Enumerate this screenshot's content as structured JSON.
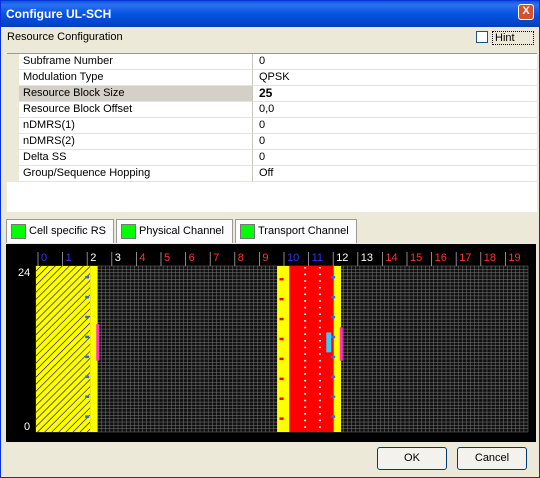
{
  "window": {
    "title": "Configure UL-SCH",
    "close_glyph": "X"
  },
  "resource_config": {
    "label": "Resource Configuration",
    "hint_label": "Hint",
    "hint_checked": false,
    "selected_row": "Resource Block Size",
    "rows": [
      {
        "name": "Subframe Number",
        "value": "0"
      },
      {
        "name": "Modulation Type",
        "value": "QPSK"
      },
      {
        "name": "Resource Block Size",
        "value": "25"
      },
      {
        "name": "Resource Block Offset",
        "value": "0,0"
      },
      {
        "name": "nDMRS(1)",
        "value": "0"
      },
      {
        "name": "nDMRS(2)",
        "value": "0"
      },
      {
        "name": "Delta SS",
        "value": "0"
      },
      {
        "name": "Group/Sequence Hopping",
        "value": "Off"
      }
    ]
  },
  "legend_tabs": [
    {
      "label": "Cell specific RS",
      "color": "#00ff00"
    },
    {
      "label": "Physical Channel",
      "color": "#00ff00"
    },
    {
      "label": "Transport Channel",
      "color": "#00ff00"
    }
  ],
  "resource_grid": {
    "y_top_label": "24",
    "y_bottom_label": "0",
    "symbol_labels": [
      "0",
      "1",
      "2",
      "3",
      "4",
      "5",
      "6",
      "7",
      "8",
      "9",
      "10",
      "11",
      "12",
      "13",
      "14",
      "15",
      "16",
      "17",
      "18",
      "19"
    ],
    "symbol_label_colors": [
      "#3333ff",
      "#3333ff",
      "#ffffff",
      "#ffffff",
      "#ff3333",
      "#ff3333",
      "#ff3333",
      "#ff3333",
      "#ff3333",
      "#ff3333",
      "#3333ff",
      "#3333ff",
      "#ffffff",
      "#ffffff",
      "#ff3333",
      "#ff3333",
      "#ff3333",
      "#ff3333",
      "#ff3333",
      "#ff3333"
    ],
    "colors": {
      "grid_line": "#7a7a7a",
      "cell": "#111111",
      "hatch_fill": "#ffff00",
      "yellow_column": "#ffff00",
      "red_block": "#ff0000",
      "pink_marker": "#ff33cc",
      "blue_marker": "#3366ff",
      "cyan_marker": "#33ccff"
    }
  },
  "buttons": {
    "ok": "OK",
    "cancel": "Cancel"
  }
}
